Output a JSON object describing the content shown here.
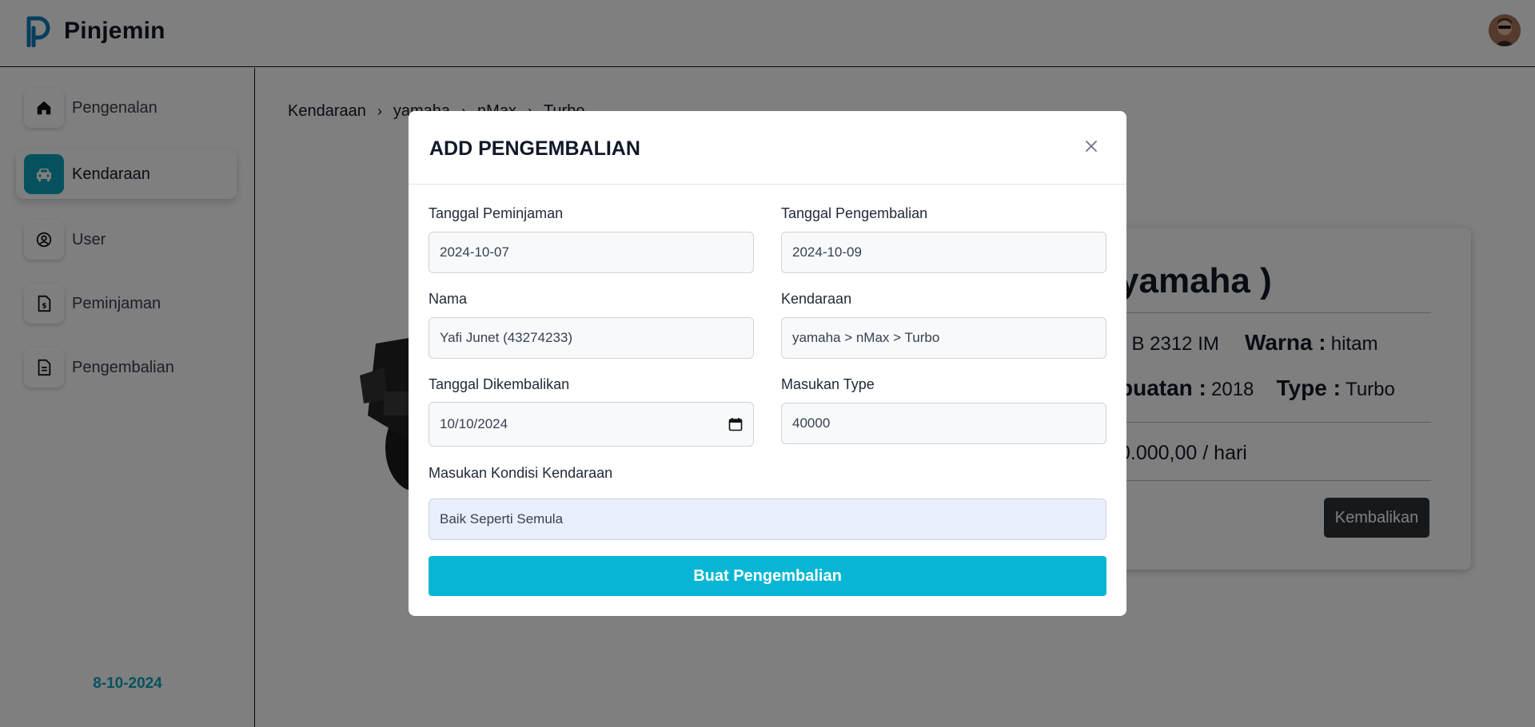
{
  "app": {
    "name": "Pinjemin"
  },
  "colors": {
    "accent": "#0aa5bd",
    "button": "#06b6d4",
    "dark_button": "#2d3338"
  },
  "sidebar": {
    "items": [
      {
        "label": "Pengenalan",
        "icon": "home-icon"
      },
      {
        "label": "Kendaraan",
        "icon": "car-icon",
        "active": true
      },
      {
        "label": "User",
        "icon": "user-circle-icon"
      },
      {
        "label": "Peminjaman",
        "icon": "document-dollar-icon"
      },
      {
        "label": "Pengembalian",
        "icon": "document-icon"
      }
    ],
    "date": "8-10-2024"
  },
  "breadcrumb": [
    "Kendaraan",
    "yamaha",
    "nMax",
    "Turbo"
  ],
  "vehicle_card": {
    "title": "yamaha )",
    "plate_label": ":",
    "plate": "B 2312 IM",
    "color_label": "Warna :",
    "color": "hitam",
    "year_label": "buatan :",
    "year": "2018",
    "type_label": "Type :",
    "type": "Turbo",
    "price": "0.000,00",
    "price_unit": "/ hari",
    "button": "Kembalikan"
  },
  "modal": {
    "title": "ADD PENGEMBALIAN",
    "fields": {
      "tanggal_peminjaman": {
        "label": "Tanggal Peminjaman",
        "value": "2024-10-07"
      },
      "tanggal_pengembalian": {
        "label": "Tanggal Pengembalian",
        "value": "2024-10-09"
      },
      "nama": {
        "label": "Nama",
        "value": "Yafi Junet (43274233)"
      },
      "kendaraan": {
        "label": "Kendaraan",
        "value": "yamaha > nMax > Turbo"
      },
      "tanggal_dikembalikan": {
        "label": "Tanggal Dikembalikan",
        "value": "10/10/2024"
      },
      "masukan_type": {
        "label": "Masukan Type",
        "value": "40000"
      },
      "kondisi": {
        "label": "Masukan Kondisi Kendaraan",
        "value": "Baik Seperti Semula"
      }
    },
    "submit": "Buat Pengembalian"
  }
}
